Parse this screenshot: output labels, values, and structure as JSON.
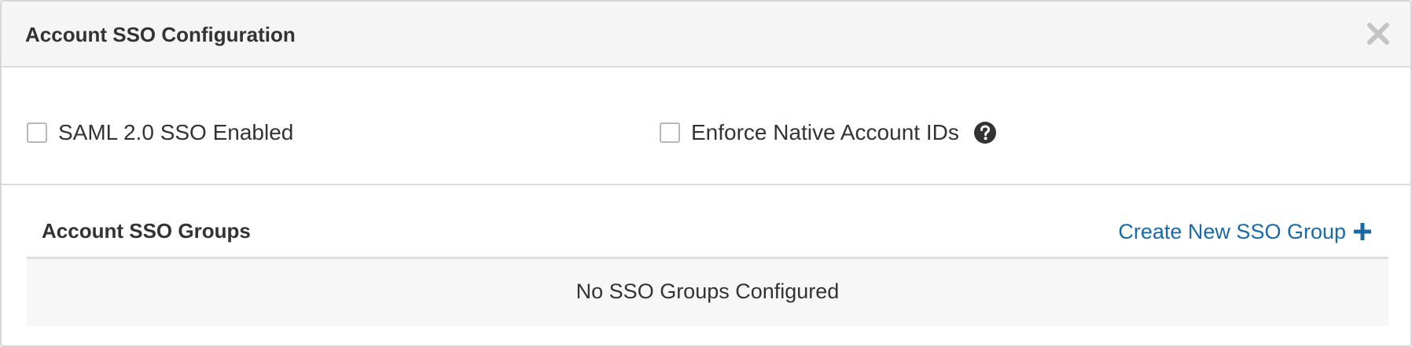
{
  "modal": {
    "title": "Account SSO Configuration",
    "close_icon": "close-icon"
  },
  "options": {
    "saml": {
      "label": "SAML 2.0 SSO Enabled",
      "checked": false
    },
    "enforce_native": {
      "label": "Enforce Native Account IDs",
      "checked": false,
      "help_icon": "question-circle-icon"
    }
  },
  "groups": {
    "title": "Account SSO Groups",
    "create_label": "Create New SSO Group",
    "create_icon": "plus-icon",
    "empty_message": "No SSO Groups Configured"
  },
  "colors": {
    "header_bg": "#f5f5f5",
    "link": "#1a6aa8",
    "text": "#333333",
    "close_icon": "#c4c4c4",
    "empty_bg": "#f7f7f7"
  }
}
